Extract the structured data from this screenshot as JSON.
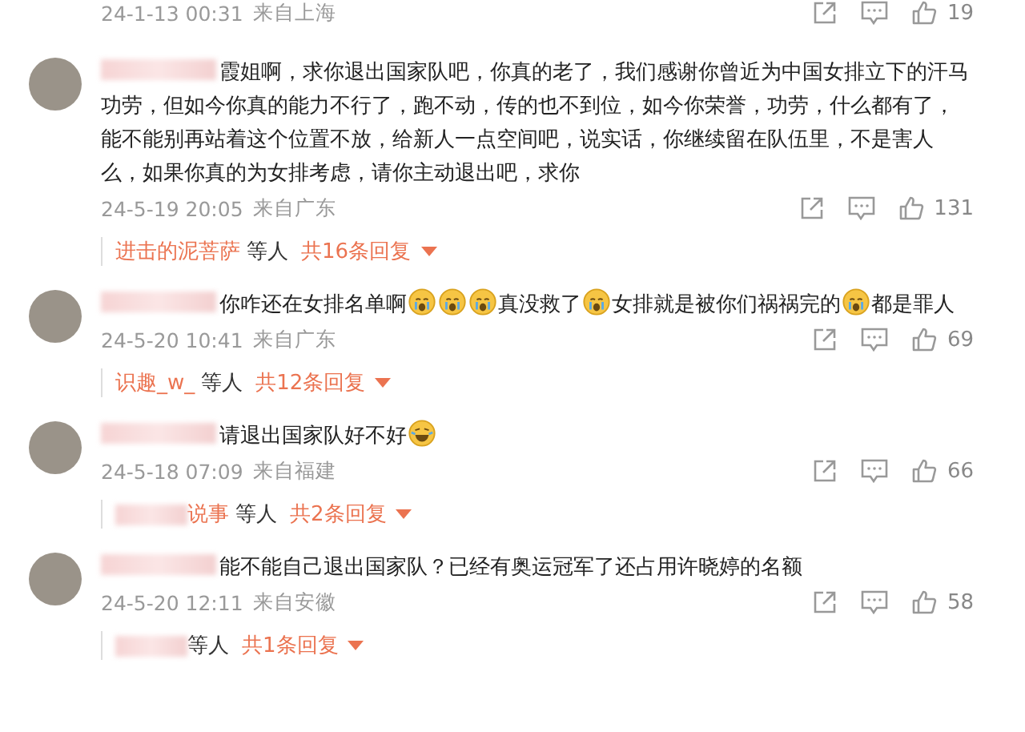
{
  "top_meta": {
    "time": "24-1-13 00:31",
    "location": "来自上海",
    "likes": "19"
  },
  "comments": [
    {
      "author_blurred": true,
      "segments": [
        {
          "kind": "text",
          "text": "霞姐啊，求你退出国家队吧，你真的老了，我们感谢你曾近为中国女排立下的汗马功劳，但如今你真的能力不行了，跑不动，传的也不到位，如今你荣誉，功劳，什么都有了，能不能别再站着这个位置不放，给新人一点空间吧，说实话，你继续留在队伍里，不是害人么，如果你真的为女排考虑，请你主动退出吧，求你"
        }
      ],
      "time": "24-5-19 20:05",
      "location": "来自广东",
      "likes": "131",
      "replies": {
        "names_blurred": false,
        "names": "进击的泥菩萨",
        "suffix": "等人",
        "count": "共16条回复"
      }
    },
    {
      "author_blurred": true,
      "segments": [
        {
          "kind": "text",
          "text": "你咋还在女排名单啊"
        },
        {
          "kind": "emoji"
        },
        {
          "kind": "emoji"
        },
        {
          "kind": "emoji"
        },
        {
          "kind": "text",
          "text": "真没救了"
        },
        {
          "kind": "emoji"
        },
        {
          "kind": "text",
          "text": "女排就是被你们祸祸完的"
        },
        {
          "kind": "emoji"
        },
        {
          "kind": "text",
          "text": "都是罪人"
        }
      ],
      "time": "24-5-20 10:41",
      "location": "来自广东",
      "likes": "69",
      "replies": {
        "names_blurred": false,
        "names": "识趣_w_",
        "suffix": "等人",
        "count": "共12条回复"
      }
    },
    {
      "author_blurred": true,
      "segments": [
        {
          "kind": "text",
          "text": "请退出国家队好不好"
        },
        {
          "kind": "laugh"
        }
      ],
      "time": "24-5-18 07:09",
      "location": "来自福建",
      "likes": "66",
      "replies": {
        "names_blurred": true,
        "names": "说事",
        "suffix": "等人",
        "count": "共2条回复"
      }
    },
    {
      "author_blurred": true,
      "segments": [
        {
          "kind": "text",
          "text": "能不能自己退出国家队？已经有奥运冠军了还占用许晓婷的名额"
        }
      ],
      "time": "24-5-20 12:11",
      "location": "来自安徽",
      "likes": "58",
      "replies": {
        "names_blurred": true,
        "suffix": "等人",
        "count": "共1条回复"
      }
    }
  ]
}
